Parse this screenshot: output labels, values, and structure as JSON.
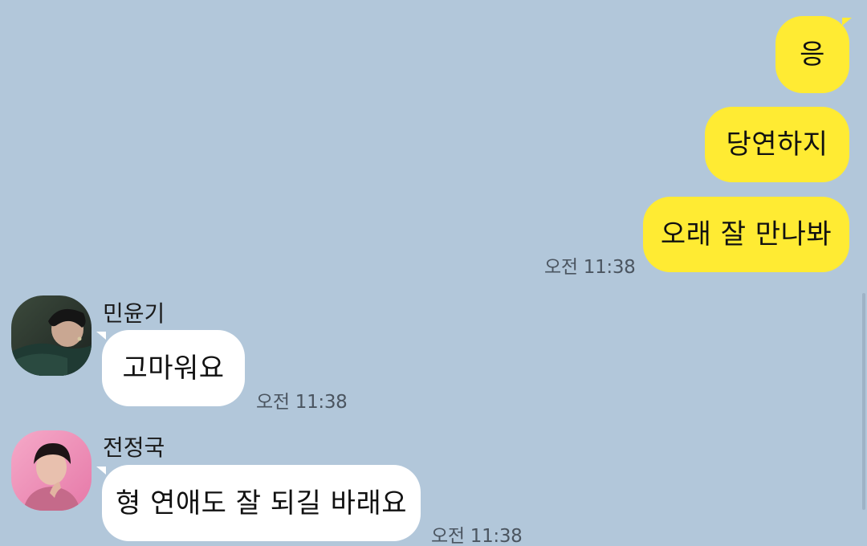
{
  "outgoing": [
    {
      "text": "응"
    },
    {
      "text": "당연하지"
    },
    {
      "text": "오래 잘 만나봐",
      "time": "오전 11:38"
    }
  ],
  "incoming": [
    {
      "sender": "민윤기",
      "text": "고마워요",
      "time": "오전 11:38",
      "avatar_icon": "profile-photo-icon"
    },
    {
      "sender": "전정국",
      "text": "형 연애도 잘 되길 바래요",
      "time": "오전 11:38",
      "avatar_icon": "profile-photo-icon"
    }
  ],
  "colors": {
    "background": "#b2c7da",
    "outgoing_bubble": "#ffeb33",
    "incoming_bubble": "#ffffff"
  }
}
